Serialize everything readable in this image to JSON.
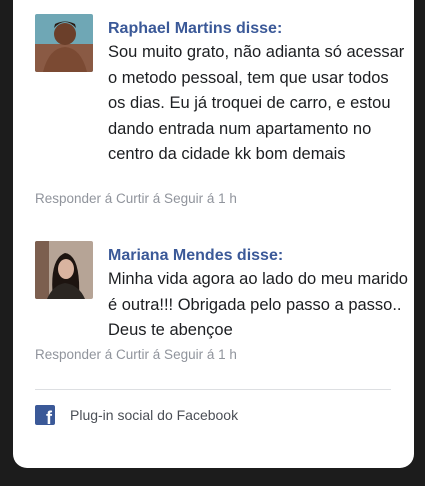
{
  "comments": [
    {
      "author": "Raphael Martins disse:",
      "text": "Sou muito grato, não adianta só acessar o metodo pessoal, tem que usar todos os dias. Eu já troquei de carro, e estou dando entrada num apartamento no centro da cidade kk bom demais",
      "meta": "Responder á Curtir á Seguir á 1 h"
    },
    {
      "author": "Mariana Mendes disse:",
      "text": "Minha vida agora ao lado do meu marido é outra!!! Obrigada pelo passo a passo.. Deus te abençoe",
      "meta": "Responder á Curtir á Seguir á 1 h"
    }
  ],
  "footer": {
    "plugin_label": "Plug-in social do Facebook",
    "icon": "facebook-icon",
    "brand_color": "#3b5998"
  }
}
